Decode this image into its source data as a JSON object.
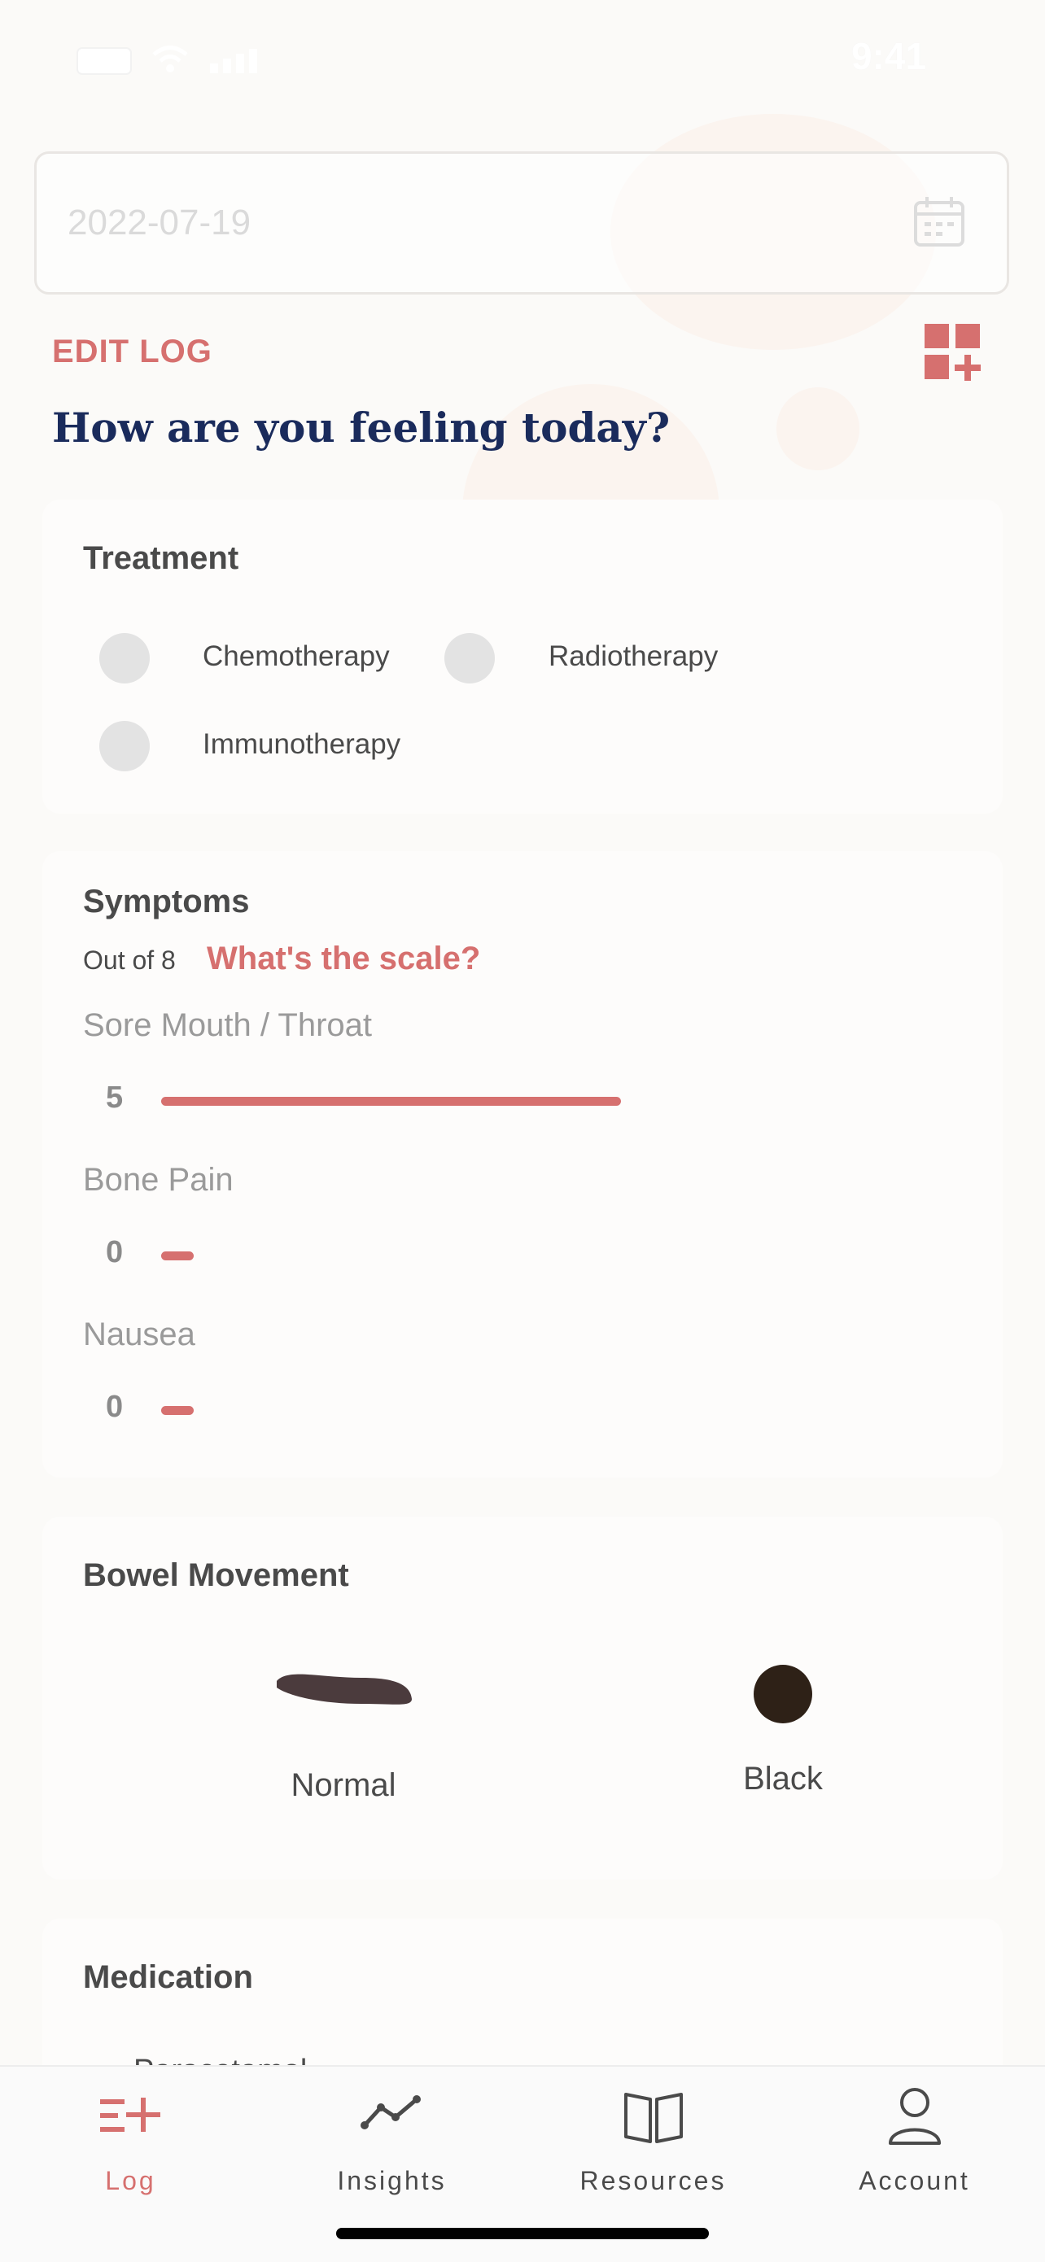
{
  "status_bar": {
    "time": "9:41"
  },
  "date_field": {
    "value": "2022-07-19"
  },
  "header": {
    "edit_label": "EDIT LOG",
    "question": "How are you feeling today?"
  },
  "treatment": {
    "title": "Treatment",
    "options": [
      "Chemotherapy",
      "Radiotherapy",
      "Immunotherapy"
    ]
  },
  "symptoms": {
    "title": "Symptoms",
    "scale_prefix": "Out of 8",
    "scale_link": "What's the scale?",
    "max": 8,
    "items": [
      {
        "name": "Sore Mouth / Throat",
        "value": 5
      },
      {
        "name": "Bone Pain",
        "value": 0
      },
      {
        "name": "Nausea",
        "value": 0
      }
    ]
  },
  "bowel": {
    "title": "Bowel Movement",
    "options": [
      {
        "label": "Normal",
        "color": "#4b3b3d"
      },
      {
        "label": "Black",
        "color": "#2e2117"
      }
    ]
  },
  "medication": {
    "title": "Medication",
    "first_item_partial": "Paracetamol"
  },
  "nav": {
    "items": [
      {
        "label": "Log",
        "icon": "log-add-icon",
        "active": true
      },
      {
        "label": "Insights",
        "icon": "insights-line-icon",
        "active": false
      },
      {
        "label": "Resources",
        "icon": "book-icon",
        "active": false
      },
      {
        "label": "Account",
        "icon": "person-icon",
        "active": false
      }
    ]
  },
  "colors": {
    "accent": "#d6706f",
    "heading": "#1a2b5c",
    "background": "#fbfaf8"
  }
}
